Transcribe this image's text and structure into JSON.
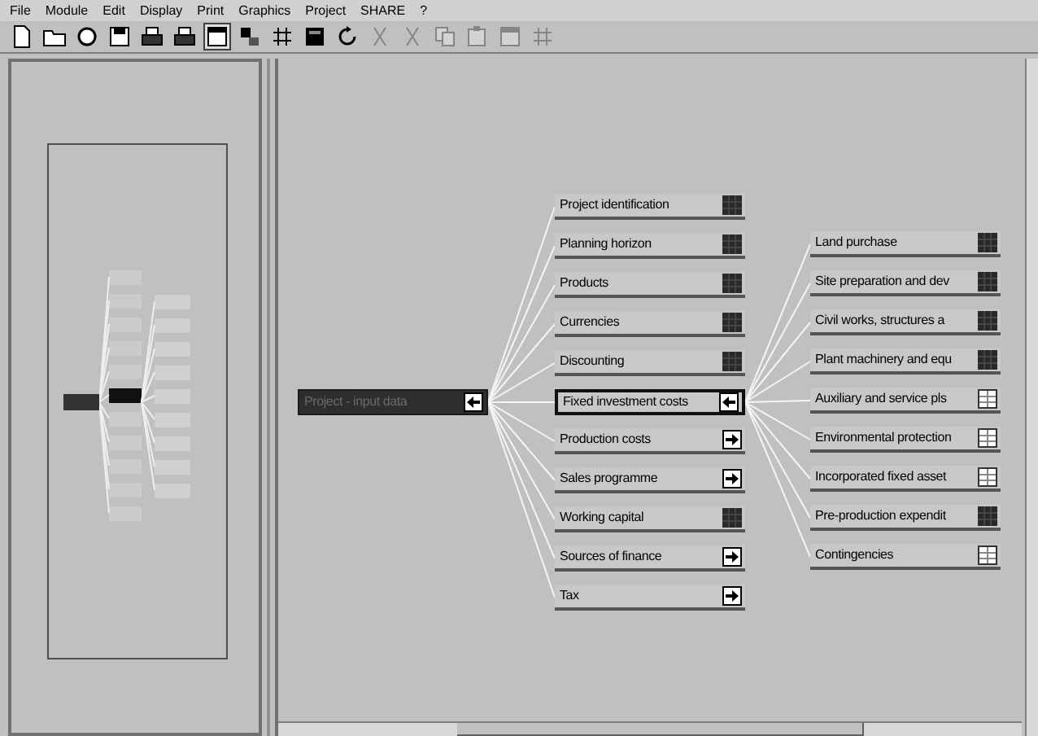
{
  "menu": [
    {
      "label": "File"
    },
    {
      "label": "Module"
    },
    {
      "label": "Edit"
    },
    {
      "label": "Display"
    },
    {
      "label": "Print"
    },
    {
      "label": "Graphics"
    },
    {
      "label": "Project"
    },
    {
      "label": "SHARE"
    },
    {
      "label": "?"
    }
  ],
  "toolbar": [
    {
      "kind": "new",
      "disabled": false,
      "pressed": false
    },
    {
      "kind": "open",
      "disabled": false,
      "pressed": false
    },
    {
      "kind": "close",
      "disabled": false,
      "pressed": false
    },
    {
      "kind": "save",
      "disabled": false,
      "pressed": false
    },
    {
      "kind": "print",
      "disabled": false,
      "pressed": false
    },
    {
      "kind": "print",
      "disabled": false,
      "pressed": false
    },
    {
      "kind": "window",
      "disabled": false,
      "pressed": true
    },
    {
      "kind": "tree",
      "disabled": false,
      "pressed": false
    },
    {
      "kind": "grid",
      "disabled": false,
      "pressed": false
    },
    {
      "kind": "square",
      "disabled": false,
      "pressed": false
    },
    {
      "kind": "refresh",
      "disabled": false,
      "pressed": false
    },
    {
      "kind": "cut",
      "disabled": true,
      "pressed": false
    },
    {
      "kind": "cut",
      "disabled": true,
      "pressed": false
    },
    {
      "kind": "copy",
      "disabled": true,
      "pressed": false
    },
    {
      "kind": "paste",
      "disabled": true,
      "pressed": false
    },
    {
      "kind": "window",
      "disabled": true,
      "pressed": false
    },
    {
      "kind": "grid",
      "disabled": true,
      "pressed": false
    }
  ],
  "root": {
    "label": "Project - input data",
    "kind": "back"
  },
  "modules": [
    {
      "label": "Project identification",
      "kind": "data",
      "selected": false
    },
    {
      "label": "Planning horizon",
      "kind": "data",
      "selected": false
    },
    {
      "label": "Products",
      "kind": "data",
      "selected": false
    },
    {
      "label": "Currencies",
      "kind": "data",
      "selected": false
    },
    {
      "label": "Discounting",
      "kind": "data",
      "selected": false
    },
    {
      "label": "Fixed investment costs",
      "kind": "back",
      "selected": true
    },
    {
      "label": "Production costs",
      "kind": "forward",
      "selected": false
    },
    {
      "label": "Sales programme",
      "kind": "forward",
      "selected": false
    },
    {
      "label": "Working capital",
      "kind": "data",
      "selected": false
    },
    {
      "label": "Sources of finance",
      "kind": "forward",
      "selected": false
    },
    {
      "label": "Tax",
      "kind": "forward",
      "selected": false
    }
  ],
  "submodules": [
    {
      "label": "Land purchase",
      "kind": "data",
      "selected": false
    },
    {
      "label": "Site preparation and dev",
      "kind": "data",
      "selected": false
    },
    {
      "label": "Civil works, structures a",
      "kind": "data",
      "selected": false
    },
    {
      "label": "Plant machinery and equ",
      "kind": "data",
      "selected": false
    },
    {
      "label": "Auxiliary and service pls",
      "kind": "table",
      "selected": false
    },
    {
      "label": "Environmental protection",
      "kind": "table",
      "selected": false
    },
    {
      "label": "Incorporated fixed asset",
      "kind": "table",
      "selected": false
    },
    {
      "label": "Pre-production expendit",
      "kind": "data",
      "selected": false
    },
    {
      "label": "Contingencies",
      "kind": "table",
      "selected": false
    }
  ]
}
